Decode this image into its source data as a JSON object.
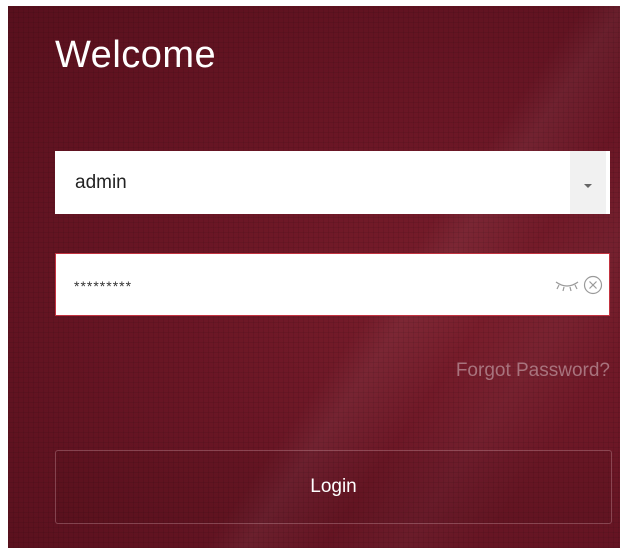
{
  "header": {
    "title": "Welcome"
  },
  "login_form": {
    "username": {
      "value": "admin",
      "dropdown_icon": "caret-down-icon"
    },
    "password": {
      "masked_value": "*********",
      "show_password_icon": "eye-closed-icon",
      "clear_icon": "clear-circle-x-icon"
    },
    "forgot_password_label": "Forgot Password?",
    "login_label": "Login"
  },
  "colors": {
    "background": "#6a1625",
    "password_border": "#c23340",
    "forgot_link": "#a8737d",
    "field_background": "#ffffff"
  }
}
